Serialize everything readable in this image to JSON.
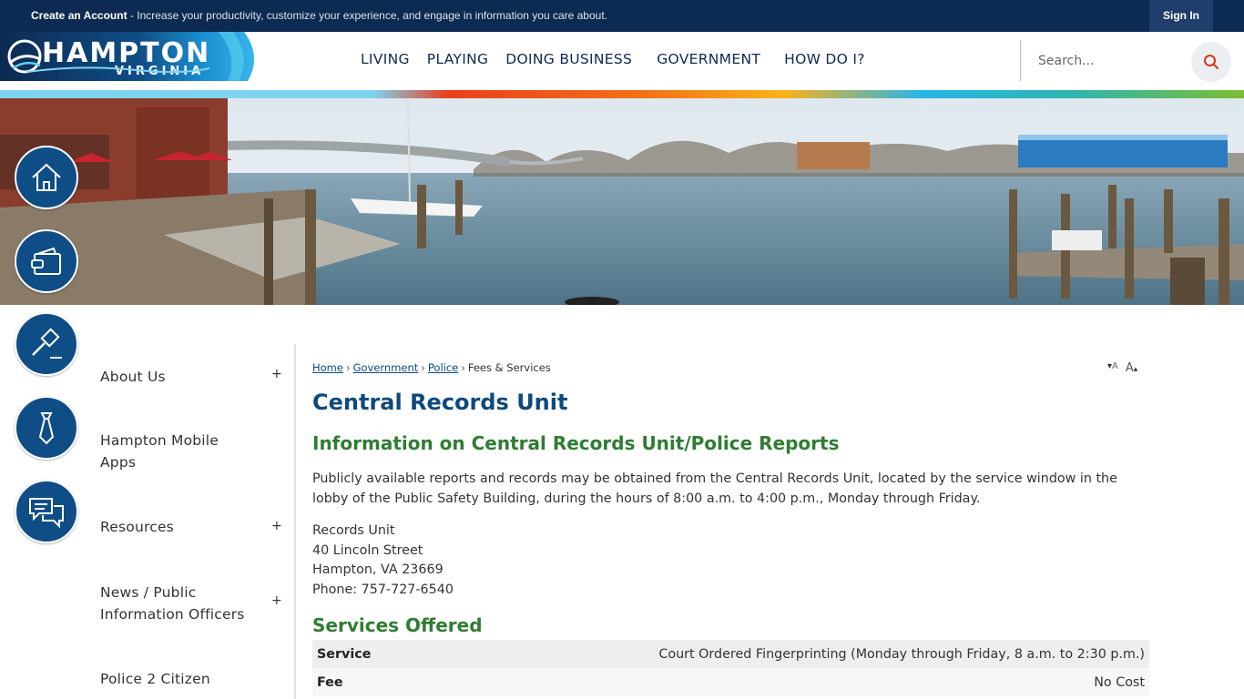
{
  "topbar": {
    "promo_bold": "Create an Account",
    "promo_text": " - Increase your productivity, customize your experience, and engage in information you care about.",
    "sign_in": "Sign In"
  },
  "logo": {
    "line1": "HAMPTON",
    "line2": "VIRGINIA"
  },
  "nav": [
    "LIVING",
    "PLAYING",
    "DOING BUSINESS",
    "GOVERNMENT",
    "HOW DO I?"
  ],
  "search": {
    "placeholder": "Search..."
  },
  "quick_links": [
    "home-icon",
    "wallet-icon",
    "gavel-icon",
    "tie-icon",
    "chat-icon"
  ],
  "sidebar": {
    "items": [
      {
        "label": "About Us",
        "expandable": true
      },
      {
        "label": "Hampton Mobile Apps",
        "expandable": false
      },
      {
        "label": "Resources",
        "expandable": true
      },
      {
        "label": "News / Public Information Officers",
        "expandable": true
      },
      {
        "label": "Police 2 Citizen",
        "expandable": false
      }
    ],
    "plus": "+"
  },
  "breadcrumb": {
    "links": [
      "Home",
      "Government",
      "Police"
    ],
    "current": "Fees & Services",
    "separator": "›"
  },
  "font_controls": {
    "decrease": "A",
    "increase": "A"
  },
  "page": {
    "title": "Central Records Unit",
    "section1_heading": "Information on Central Records Unit/Police Reports",
    "section1_text": "Publicly available reports and records may be obtained from the Central Records Unit, located by the service window in the lobby of the Public Safety Building, during the hours of 8:00 a.m. to 4:00 p.m., Monday through Friday.",
    "address": [
      "Records Unit",
      "40 Lincoln Street",
      "Hampton, VA 23669",
      "Phone: 757-727-6540"
    ],
    "section2_heading": "Services Offered",
    "services": [
      {
        "key": "Service",
        "value": "Court Ordered Fingerprinting (Monday through Friday, 8 a.m. to 2:30 p.m.)"
      },
      {
        "key": "Fee",
        "value": "No Cost"
      }
    ]
  }
}
